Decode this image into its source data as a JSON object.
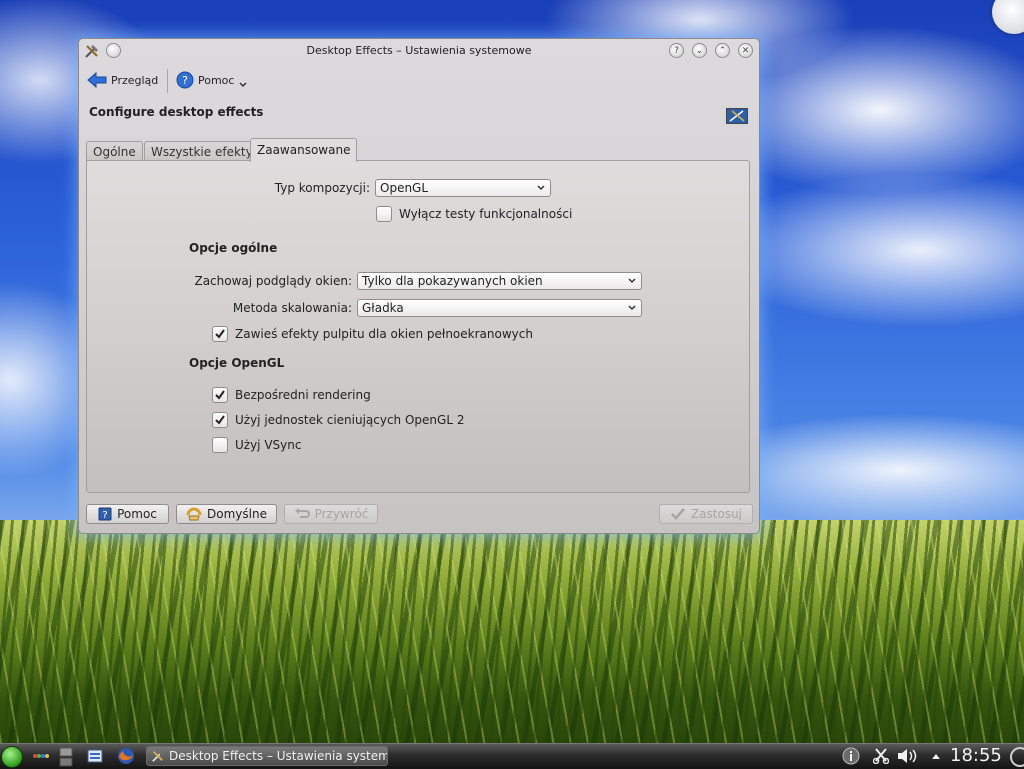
{
  "window": {
    "title": "Desktop Effects – Ustawienia systemowe",
    "header_title": "Configure desktop effects"
  },
  "titlebar_buttons": [
    "?",
    "⌄",
    "⌃",
    "✕"
  ],
  "toolbar": {
    "overview_label": "Przegląd",
    "help_label": "Pomoc"
  },
  "tabs": [
    {
      "label": "Ogólne"
    },
    {
      "label": "Wszystkie efekty"
    },
    {
      "label": "Zaawansowane"
    }
  ],
  "advanced": {
    "compositing_type_label": "Typ kompozycji:",
    "compositing_type_value": "OpenGL",
    "disable_tests_label": "Wyłącz testy funkcjonalności",
    "disable_tests_checked": false,
    "general_section": "Opcje ogólne",
    "keep_thumbnails_label": "Zachowaj podglądy okien:",
    "keep_thumbnails_value": "Tylko dla pokazywanych okien",
    "scale_method_label": "Metoda skalowania:",
    "scale_method_value": "Gładka",
    "suspend_fullscreen_label": "Zawieś efekty pulpitu dla okien pełnoekranowych",
    "suspend_fullscreen_checked": true,
    "opengl_section": "Opcje OpenGL",
    "direct_rendering_label": "Bezpośredni rendering",
    "direct_rendering_checked": true,
    "glsl_label": "Użyj jednostek cieniujących OpenGL 2",
    "glsl_checked": true,
    "vsync_label": "Użyj VSync",
    "vsync_checked": false
  },
  "buttons": {
    "help": "Pomoc",
    "defaults": "Domyślne",
    "reset": "Przywróć",
    "apply": "Zastosuj"
  },
  "taskbar": {
    "task_label": "Desktop Effects – Ustawienia systemowe",
    "clock": "18:55"
  },
  "colors": {
    "accent_blue": "#2f6fd6",
    "window_bg": "#d6d3d5",
    "taskbar_bg": "#2c2c2c"
  }
}
